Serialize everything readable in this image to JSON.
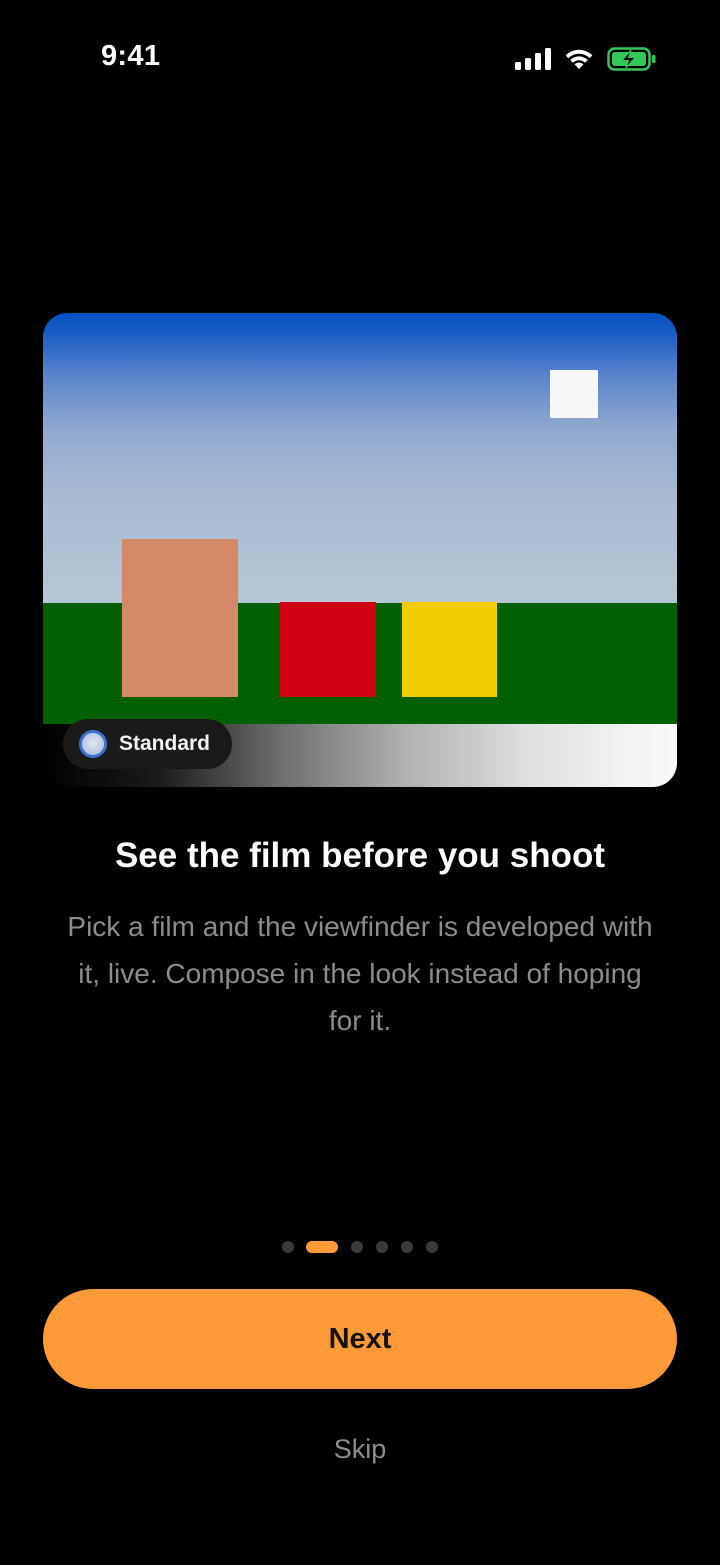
{
  "status_bar": {
    "time": "9:41",
    "icons": [
      "cellular-signal-icon",
      "wifi-icon",
      "battery-charging-icon"
    ],
    "battery_color": "#34c759"
  },
  "hero": {
    "film_chip_label": "Standard",
    "colors": {
      "sky_top": "#0050c0",
      "sky_bottom": "#b6c6d4",
      "grass": "#006000",
      "peach_block": "#d48a68",
      "red_block": "#d20014",
      "yellow_block": "#f0cc00",
      "sun": "#f7f7f7"
    }
  },
  "onboarding": {
    "title": "See the film before you shoot",
    "body": "Pick a film and the viewfinder is developed with it, live. Compose in the look instead of hoping for it."
  },
  "pager": {
    "total": 6,
    "current": 2
  },
  "actions": {
    "next_label": "Next",
    "skip_label": "Skip"
  },
  "colors": {
    "accent": "#ff9a38",
    "background": "#000000",
    "secondary_text": "#8c8c8c"
  }
}
